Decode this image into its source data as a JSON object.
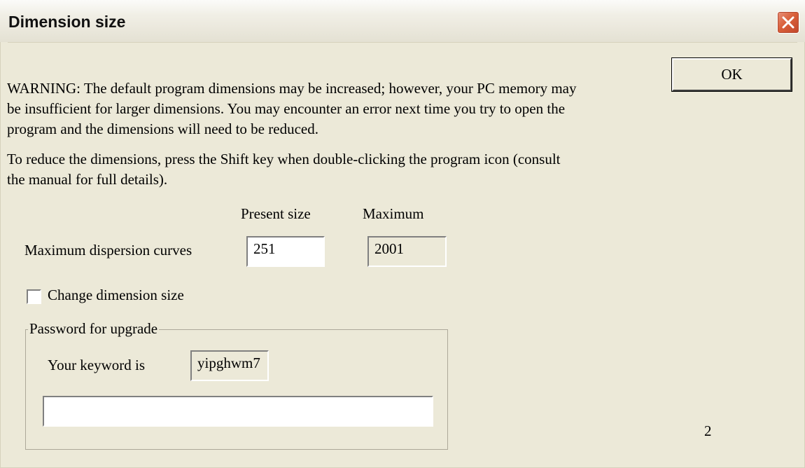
{
  "window": {
    "title": "Dimension size",
    "close_icon": "close-icon"
  },
  "warning": {
    "paragraph1": "WARNING: The default program dimensions may be increased; however, your PC memory may be insufficient for larger dimensions. You may encounter an error next time you try to open the program and the dimensions will need to be reduced.",
    "paragraph2": "To reduce the dimensions, press the Shift key when double-clicking the program icon (consult the manual for full details)."
  },
  "table": {
    "header_present": "Present size",
    "header_max": "Maximum",
    "row_label": "Maximum dispersion curves",
    "present_value": "251",
    "max_value": "2001"
  },
  "change": {
    "label": "Change dimension size",
    "checked": false
  },
  "upgrade": {
    "legend": "Password for upgrade",
    "keyword_label": "Your keyword is",
    "keyword_value": "yipghwm7",
    "password_value": ""
  },
  "ok_label": "OK",
  "corner_number": "2",
  "colors": {
    "face": "#ece9d8",
    "close_red": "#d9603b"
  }
}
